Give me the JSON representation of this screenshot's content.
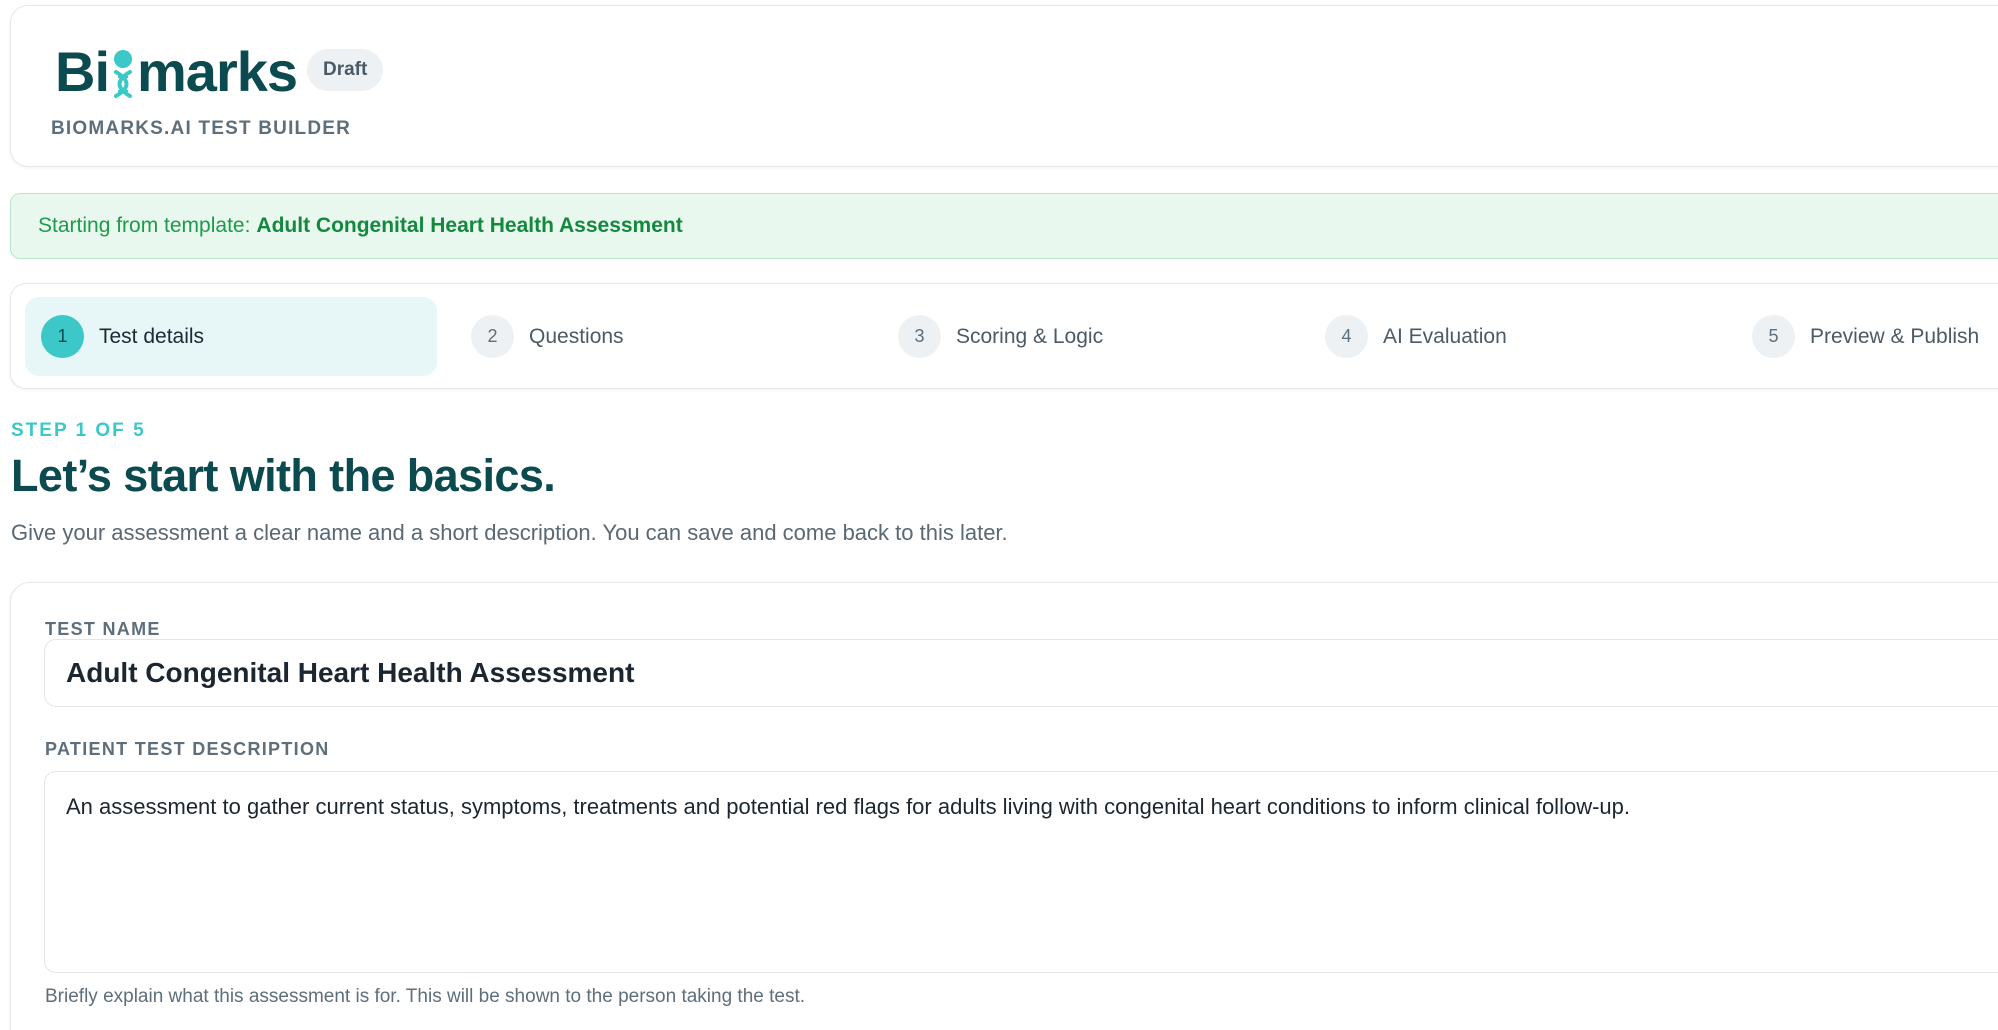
{
  "header": {
    "logo_text_before": "Bi",
    "logo_text_after": "marks",
    "logo_icon": "dna-icon",
    "status_badge": "Draft",
    "subtitle": "BIOMARKS.AI TEST BUILDER"
  },
  "template_banner": {
    "prefix": "Starting from template:",
    "template_name": "Adult Congenital Heart Health Assessment"
  },
  "stepper": {
    "steps": [
      {
        "number": "1",
        "label": "Test details"
      },
      {
        "number": "2",
        "label": "Questions"
      },
      {
        "number": "3",
        "label": "Scoring & Logic"
      },
      {
        "number": "4",
        "label": "AI Evaluation"
      },
      {
        "number": "5",
        "label": "Preview & Publish"
      }
    ],
    "active_step": 1
  },
  "page": {
    "step_counter": "STEP 1 OF 5",
    "title": "Let’s start with the basics.",
    "intro": "Give your assessment a clear name and a short description. You can save and come back to this later."
  },
  "form": {
    "test_name_label": "TEST NAME",
    "test_name_value": "Adult Congenital Heart Health Assessment",
    "description_label": "PATIENT TEST DESCRIPTION",
    "description_value": "An assessment to gather current status, symptoms, treatments and potential red flags for adults living with congenital heart conditions to inform clinical follow-up.",
    "description_help": "Briefly explain what this assessment is for. This will be shown to the person taking the test."
  },
  "colors": {
    "brand_dark": "#0b4a4f",
    "brand_accent": "#3cc8c8",
    "success_text": "#1f9a4c",
    "success_bg": "#e8f8ee"
  }
}
